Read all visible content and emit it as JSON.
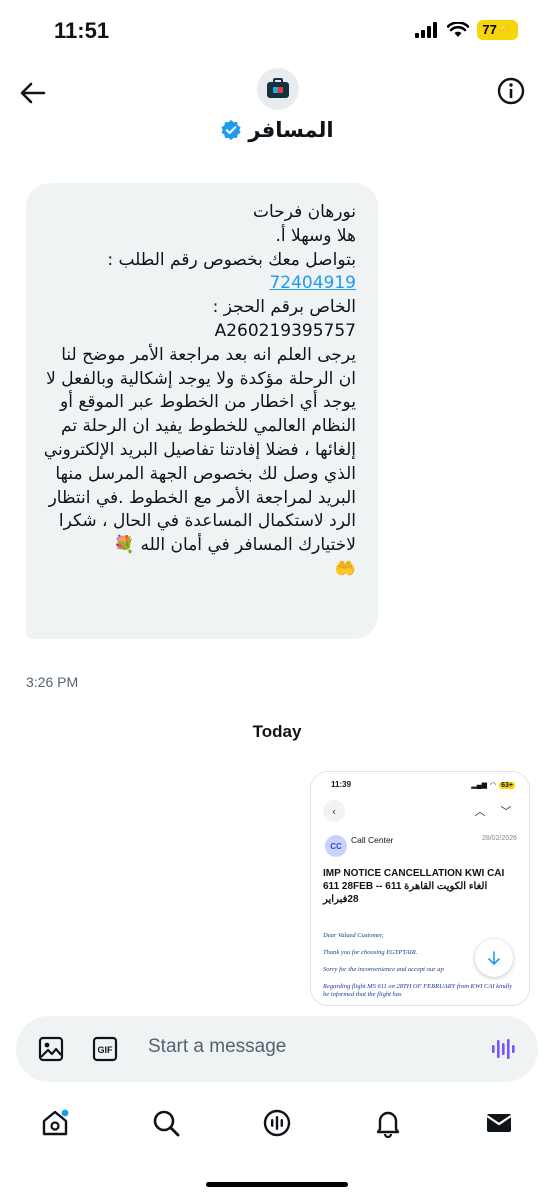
{
  "status_bar": {
    "time": "11:51",
    "battery": "77"
  },
  "header": {
    "contact_name": "المسافر"
  },
  "message": {
    "text_before_link": "نورهان فرحات\nهلا وسهلا أ. \nبتواصل معك بخصوص رقم الطلب :\n",
    "link": "72404919",
    "text_after_link": "\nالخاص برقم الحجز :\nA260219395757\nيرجى العلم انه بعد مراجعة الأمر موضح لنا ان الرحلة مؤكدة ولا يوجد إشكالية وبالفعل لا يوجد أي اخطار من الخطوط عبر الموقع أو النظام العالمي للخطوط يفيد ان الرحلة تم إلغائها ، فضلا إفادتنا تفاصيل البريد الإلكتروني الذي وصل لك بخصوص الجهة المرسل منها البريد لمراجعة الأمر مع الخطوط .في انتظار الرد لاستكمال المساعدة في الحال ، شكرا لاختيارك المسافر في أمان الله 💐\n🤲",
    "time": "3:26 PM"
  },
  "day_separator": "Today",
  "image_message": {
    "status_time": "11:39",
    "status_battery": "63+",
    "sender_initials": "CC",
    "sender_name": "Call Center",
    "date": "28/02/2026",
    "subject": "IMP NOTICE CANCELLATION KWI CAI 611 28FEB -- الغاء الكويت القاهرة 611 28فبراير",
    "body": [
      "Dear Valued Customer,",
      "Thank you for choosing EGYPTAIR.",
      "Sorry for the inconvenience and accept our ap",
      "Regarding flight MS 611    on 28TH OF FEBRUARY from   KWI CAI kindly be informed that the flight has"
    ]
  },
  "composer": {
    "placeholder": "Start a message"
  },
  "colors": {
    "accent": "#1d9bf0",
    "voice": "#7856ff",
    "bubble": "#eff3f4",
    "battery": "#f5d60a"
  }
}
